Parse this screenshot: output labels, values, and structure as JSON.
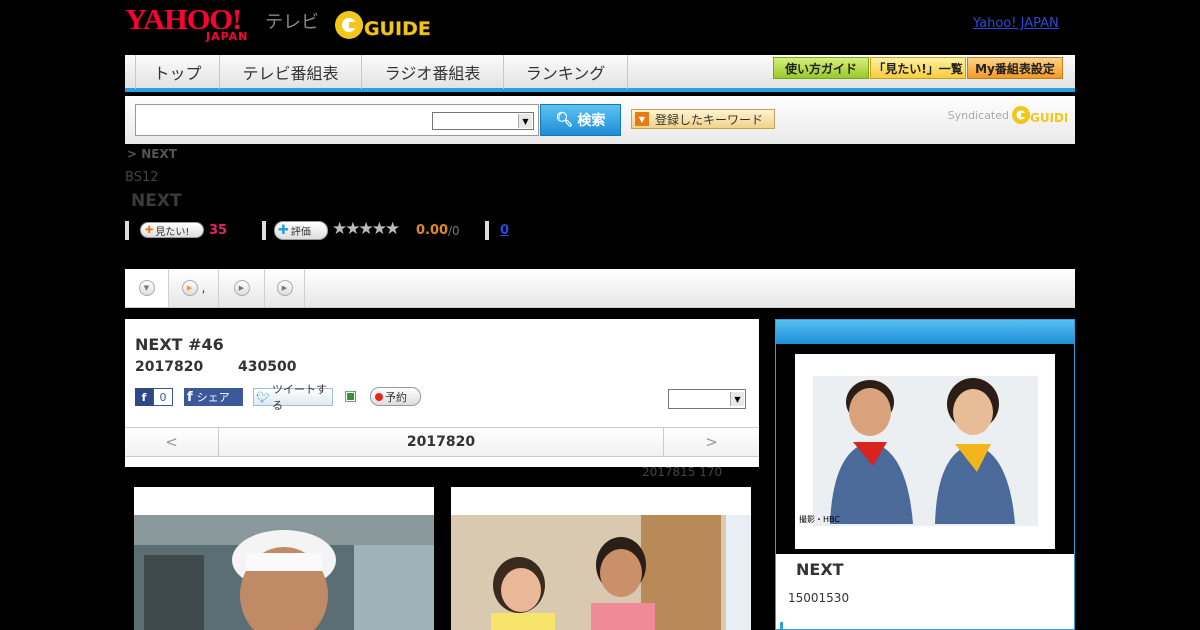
{
  "header": {
    "yahoo_logo": "YAHOO!",
    "yahoo_sub": "JAPAN",
    "tv_label": "テレビ",
    "gguide_logo": "GUIDE",
    "top_link": "Yahoo! JAPAN"
  },
  "nav": {
    "tabs": [
      "トップ",
      "テレビ番組表",
      "ラジオ番組表",
      "ランキング"
    ],
    "buttons": [
      "使い方ガイド",
      "「見たい!」一覧",
      "My番組表設定"
    ]
  },
  "search": {
    "input_value": "",
    "button_label": "検索",
    "keyword_button": "登録したキーワード",
    "syndicated": "Syndicated"
  },
  "breadcrumb": ">  NEXT",
  "channel": "BS12",
  "program_title": "NEXT",
  "stats": {
    "mitai_label": "見たい!",
    "mitai_count": "35",
    "hyoka_label": "評価",
    "stars": "★★★★★",
    "score": "0.00",
    "score_max": "/0",
    "review_count": "0"
  },
  "episode": {
    "title": "NEXT #46",
    "date": "2017820",
    "time": "430500",
    "fb_count": "0",
    "fb_share": "シェア",
    "tweet": "ツイートする",
    "reserve": "予約",
    "prev": "<",
    "nav_date": "2017820",
    "next": ">",
    "update_note": "2017815  170"
  },
  "side": {
    "photo_credit": "撮影・HBC",
    "title": "NEXT",
    "time": "15001530"
  },
  "colors": {
    "accent_blue": "#2aa0de",
    "yahoo_red": "#ff0033",
    "count_pink": "#e4226a",
    "score_orange": "#e0892a"
  }
}
